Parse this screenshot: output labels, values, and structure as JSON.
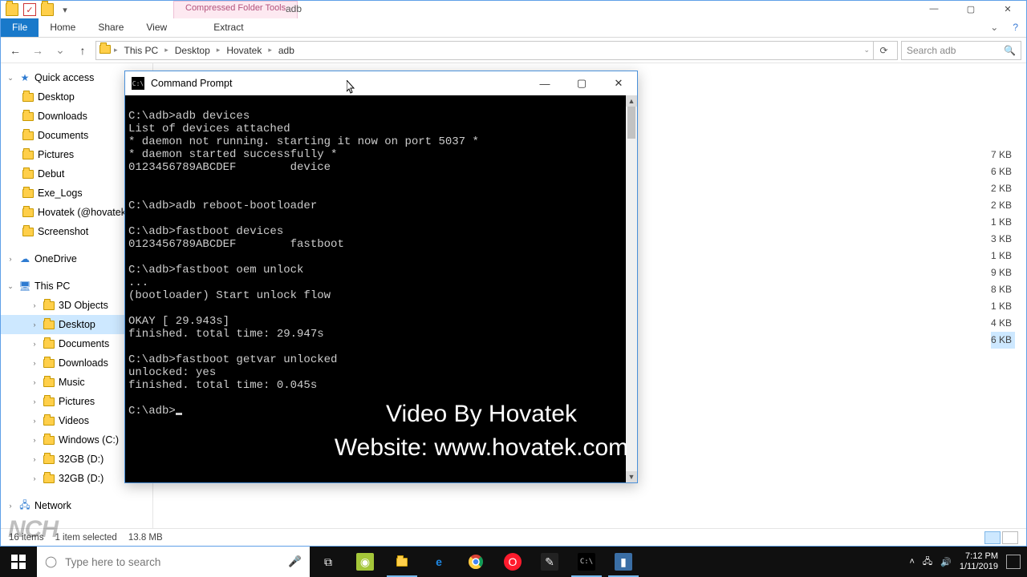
{
  "explorer": {
    "context_tab": "Compressed Folder Tools",
    "title": "adb",
    "ribbon": {
      "file": "File",
      "home": "Home",
      "share": "Share",
      "view": "View",
      "extract": "Extract"
    },
    "win": {
      "min": "—",
      "max": "▢",
      "close": "✕"
    },
    "nav": {
      "back": "←",
      "fwd": "→",
      "recent": "⌄",
      "up": "↑"
    },
    "breadcrumb": [
      "This PC",
      "Desktop",
      "Hovatek",
      "adb"
    ],
    "refresh": "⟳",
    "search_placeholder": "Search adb",
    "sidebar": {
      "quick": {
        "label": "Quick access",
        "items": [
          "Desktop",
          "Downloads",
          "Documents",
          "Pictures",
          "Debut",
          "Exe_Logs",
          "Hovatek (@hovatek",
          "Screenshot"
        ]
      },
      "onedrive": "OneDrive",
      "thispc": {
        "label": "This PC",
        "items": [
          "3D Objects",
          "Desktop",
          "Documents",
          "Downloads",
          "Music",
          "Pictures",
          "Videos",
          "Windows (C:)",
          "32GB (D:)",
          "32GB (D:)"
        ],
        "selected_index": 1
      },
      "network": "Network"
    },
    "filesizes": [
      "7 KB",
      "6 KB",
      "2 KB",
      "2 KB",
      "1 KB",
      "3 KB",
      "1 KB",
      "9 KB",
      "8 KB",
      "1 KB",
      "4 KB",
      "6 KB"
    ],
    "filesizes_selected_index": 11,
    "status": {
      "items": "16 items",
      "selected": "1 item selected",
      "size": "13.8 MB"
    }
  },
  "cmd": {
    "title": "Command Prompt",
    "win": {
      "min": "—",
      "max": "▢",
      "close": "✕"
    },
    "lines": [
      "",
      "C:\\adb>adb devices",
      "List of devices attached",
      "* daemon not running. starting it now on port 5037 *",
      "* daemon started successfully *",
      "0123456789ABCDEF        device",
      "",
      "",
      "C:\\adb>adb reboot-bootloader",
      "",
      "C:\\adb>fastboot devices",
      "0123456789ABCDEF        fastboot",
      "",
      "C:\\adb>fastboot oem unlock",
      "...",
      "(bootloader) Start unlock flow",
      "",
      "OKAY [ 29.943s]",
      "finished. total time: 29.947s",
      "",
      "C:\\adb>fastboot getvar unlocked",
      "unlocked: yes",
      "finished. total time: 0.045s",
      "",
      "C:\\adb>"
    ]
  },
  "watermark": {
    "line1": "Video By Hovatek",
    "line2": "Website: www.hovatek.com",
    "corner": "NCH"
  },
  "taskbar": {
    "search_placeholder": "Type here to search",
    "tray": {
      "time": "7:12 PM",
      "date": "1/11/2019"
    }
  }
}
